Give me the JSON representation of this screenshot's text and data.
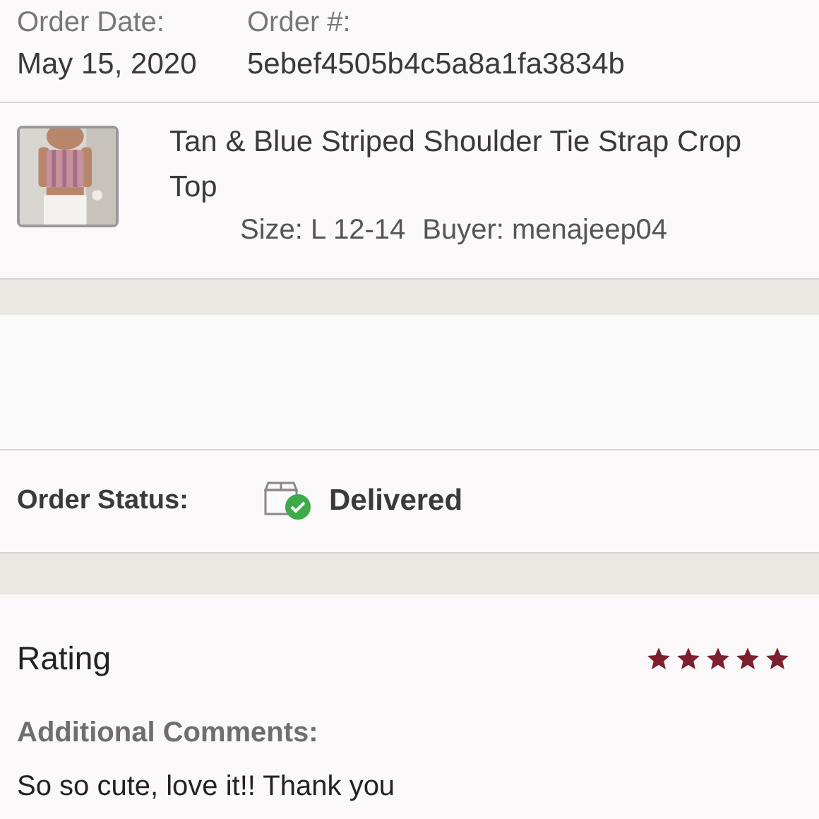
{
  "order": {
    "date_label": "Order Date:",
    "date": "May 15, 2020",
    "number_label": "Order #:",
    "number": "5ebef4505b4c5a8a1fa3834b"
  },
  "item": {
    "title": "Tan & Blue Striped Shoulder Tie Strap Crop Top",
    "size": "Size: L 12-14",
    "buyer": "Buyer: menajeep04"
  },
  "status": {
    "label": "Order Status:",
    "value": "Delivered",
    "delivered": true
  },
  "rating": {
    "label": "Rating",
    "stars": 5,
    "comments_label": "Additional Comments:",
    "comment": "So so cute, love it!! Thank you"
  }
}
